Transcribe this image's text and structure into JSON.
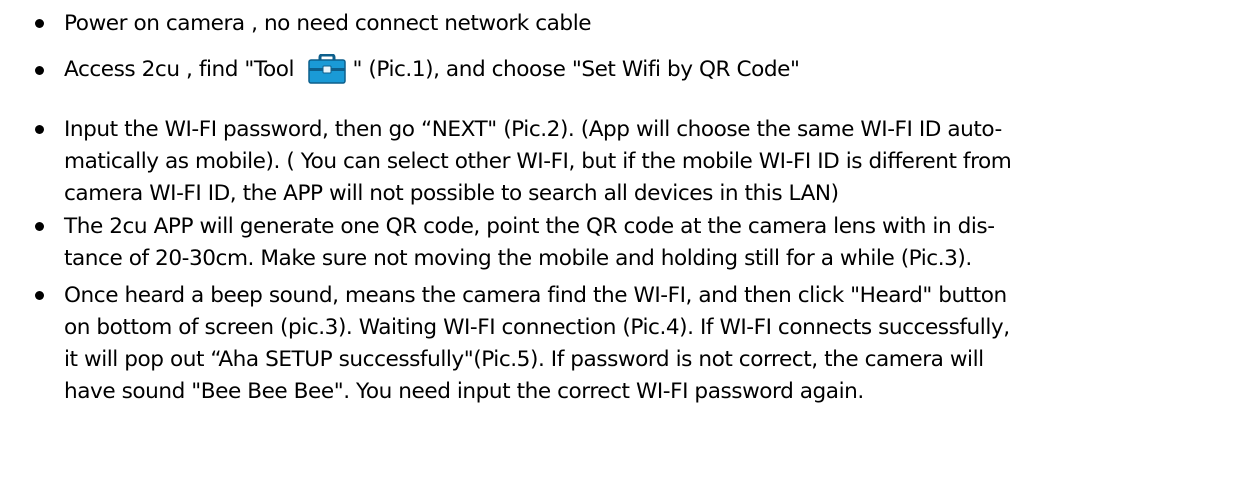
{
  "steps": [
    {
      "lines": [
        "Power on camera , no need connect network cable"
      ]
    },
    {
      "before_icon": "Access 2cu , find \"Tool ",
      "icon": "toolbox-icon",
      "after_icon": "\" (Pic.1), and choose \"Set Wifi by QR Code\""
    },
    {
      "lines": [
        "Input the WI-FI password, then go “NEXT\" (Pic.2). (App will choose the same WI-FI ID auto-",
        "matically as mobile). ( You can select other WI-FI, but if the mobile WI-FI ID is different from",
        "camera WI-FI ID, the APP will not possible to search all devices in this LAN)"
      ]
    },
    {
      "lines": [
        "The 2cu APP will generate one QR code, point the QR code at the camera lens with in dis-",
        "tance of 20-30cm. Make sure not moving the mobile and holding still for a while (Pic.3)."
      ]
    },
    {
      "lines": [
        "Once heard a beep sound, means the camera find the WI-FI, and then click \"Heard\" button",
        "on bottom of screen (pic.3). Waiting WI-FI connection (Pic.4). If WI-FI connects successfully,",
        "it will pop out “Aha SETUP successfully\"(Pic.5). If password is not correct, the camera will",
        "have sound \"Bee Bee Bee\". You need input the correct WI-FI password again."
      ]
    }
  ],
  "colors": {
    "text": "#000000",
    "icon_blue": "#1a9ad6",
    "icon_dark": "#0d5f8c"
  }
}
